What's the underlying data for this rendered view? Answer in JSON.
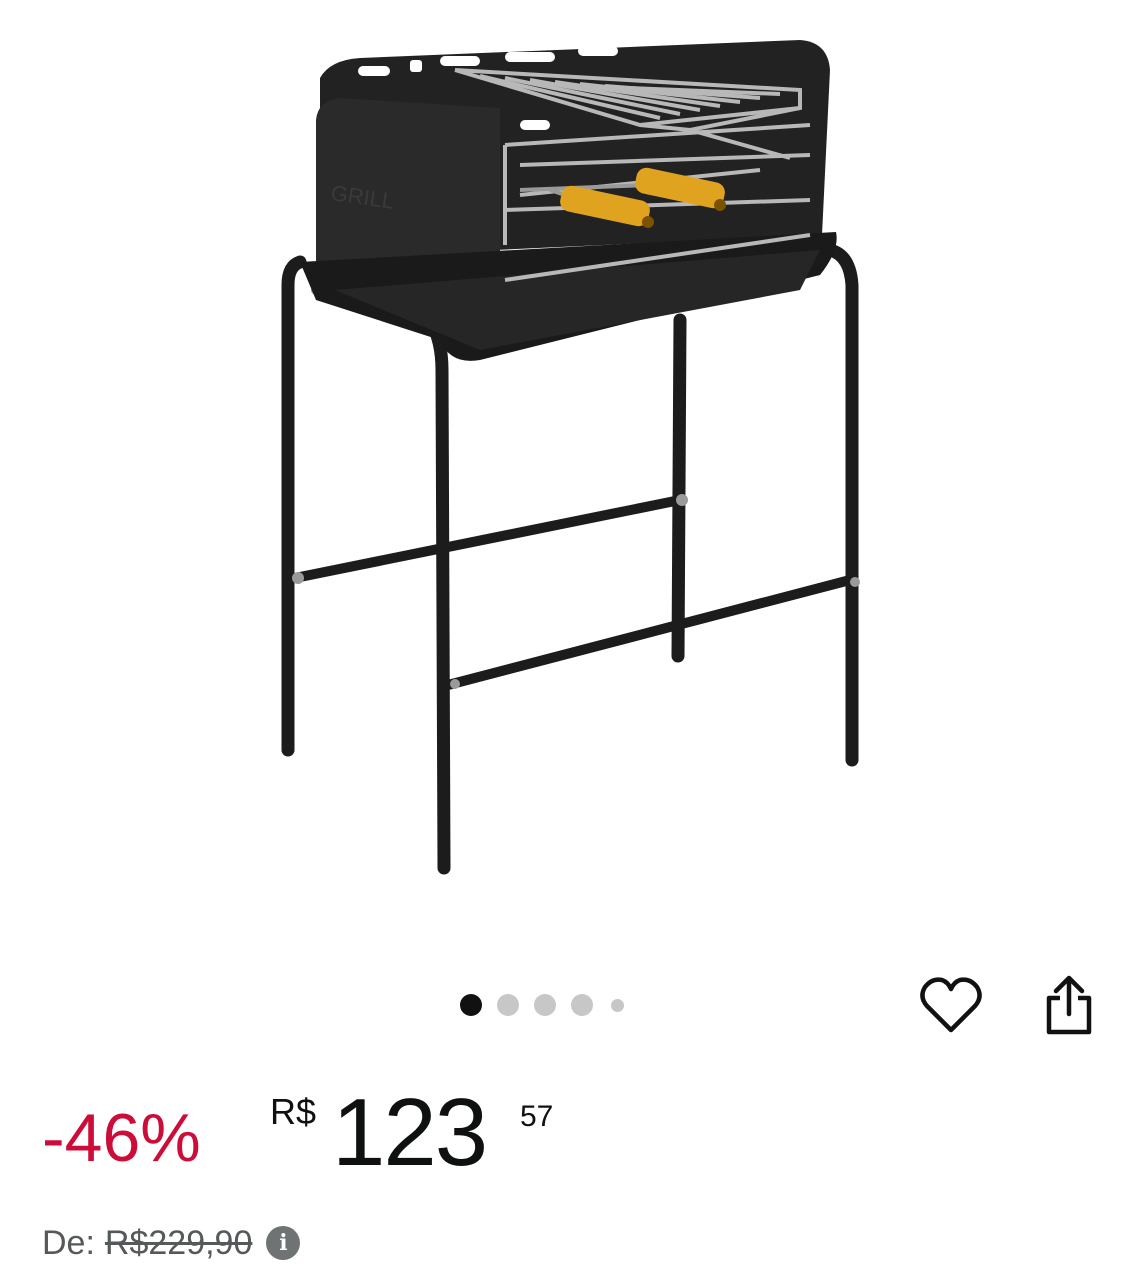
{
  "product": {
    "image_name": "portable-charcoal-grill",
    "carousel": {
      "total": 5,
      "active": 1
    }
  },
  "actions": {
    "wishlist_icon": "heart-outline-icon",
    "share_icon": "share-icon"
  },
  "price": {
    "discount": "-46%",
    "currency": "R$",
    "whole": "123",
    "cents": "57",
    "accent_color": "#cc0c39"
  },
  "list_price": {
    "label": "De:",
    "value": "R$229,90",
    "info_icon": "info-icon"
  }
}
